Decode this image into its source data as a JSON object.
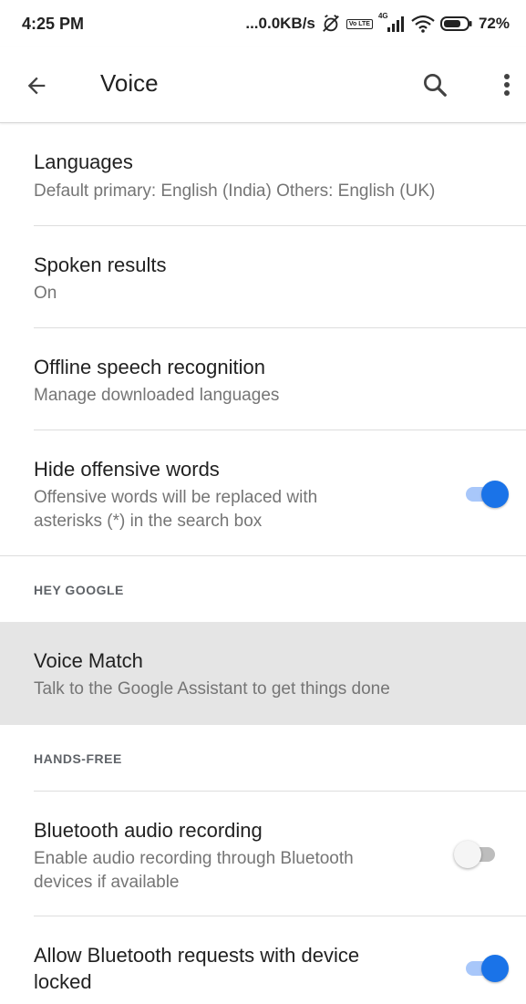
{
  "status_bar": {
    "time": "4:25 PM",
    "network_speed": "...0.0KB/s",
    "volte_badge": "Vo LTE",
    "network_type": "4G",
    "battery": "72%",
    "icons": [
      "alarm-off-icon",
      "volte-icon",
      "signal-icon",
      "wifi-icon",
      "battery-icon"
    ]
  },
  "app_bar": {
    "title": "Voice",
    "icons": [
      "back-arrow-icon",
      "search-icon",
      "more-vert-icon"
    ]
  },
  "settings": {
    "languages": {
      "title": "Languages",
      "subtitle": "Default primary: English (India) Others: English (UK)"
    },
    "spoken_results": {
      "title": "Spoken results",
      "subtitle": "On"
    },
    "offline_speech": {
      "title": "Offline speech recognition",
      "subtitle": "Manage downloaded languages"
    },
    "hide_offensive": {
      "title": "Hide offensive words",
      "subtitle_line1": "Offensive words will be replaced with",
      "subtitle_line2": "asterisks (*) in the search box",
      "toggle_on": true
    },
    "hey_google_header": "HEY GOOGLE",
    "voice_match": {
      "title": "Voice Match",
      "subtitle": "Talk to the Google Assistant to get things done"
    },
    "hands_free_header": "HANDS-FREE",
    "bluetooth_audio": {
      "title": "Bluetooth audio recording",
      "subtitle_line1": "Enable audio recording through Bluetooth",
      "subtitle_line2": "devices if available",
      "toggle_on": false
    },
    "bluetooth_locked": {
      "title_line1": "Allow Bluetooth requests with device",
      "title_line2": "locked",
      "toggle_on": true
    }
  },
  "colors": {
    "accent": "#1a73e8",
    "accent_track": "#a8c7fa",
    "highlight_row": "#e5e5e5",
    "secondary_text": "#757575"
  }
}
